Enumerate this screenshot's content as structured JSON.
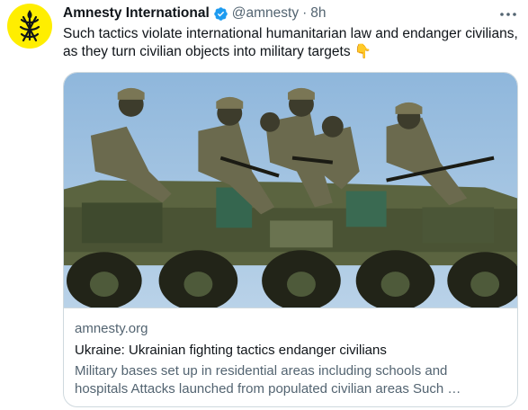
{
  "tweet": {
    "author": {
      "display_name": "Amnesty International",
      "handle": "@amnesty",
      "verified": true
    },
    "separator": "·",
    "timestamp": "8h",
    "text": "Such tactics violate international humanitarian law and endanger civilians, as they turn civilian objects into military targets 👇",
    "more_icon": "more-horizontal-icon"
  },
  "card": {
    "domain": "amnesty.org",
    "title": "Ukraine: Ukrainian fighting tactics endanger civilians",
    "description": "Military bases set up in residential areas including schools and hospitals  Attacks launched from populated civilian areas Such …",
    "image": "photo of soldiers seated on armored personnel carrier"
  },
  "colors": {
    "brand": "#ffee00",
    "verified": "#1d9bf0",
    "secondary_text": "#536471",
    "border": "#cfd9de"
  }
}
